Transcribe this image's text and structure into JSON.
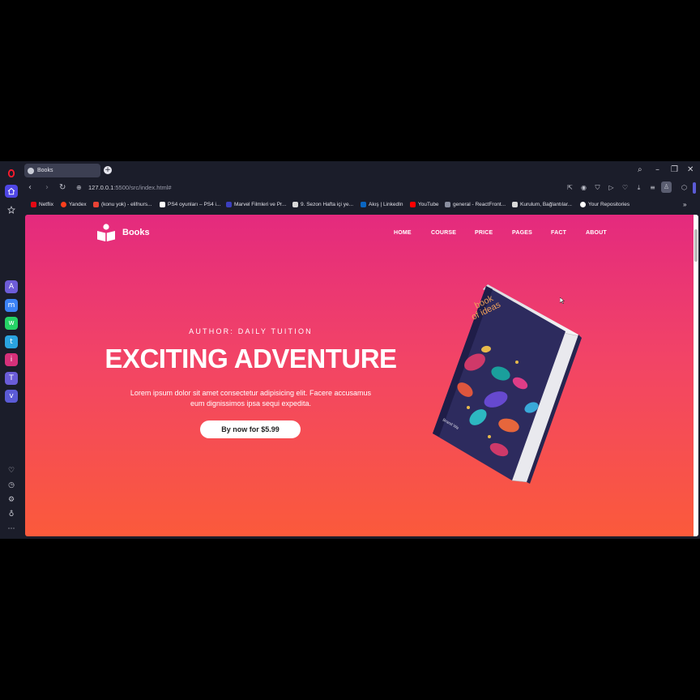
{
  "browser": {
    "tab": {
      "title": "Books"
    },
    "address": {
      "host": "127.0.0.1",
      "path": ":5500/src/index.html#"
    },
    "bookmarks": [
      {
        "label": "Netflix",
        "color": "#e50914"
      },
      {
        "label": "Yandex",
        "color": "#fc3f1d"
      },
      {
        "label": "(konu yok) - elifnurs...",
        "color": "#ea4335"
      },
      {
        "label": "PS4 oyunları – PS4 i...",
        "color": "#ffffff"
      },
      {
        "label": "Marvel Filmleri ve Pr...",
        "color": "#3b3fbf"
      },
      {
        "label": "9. Sezon Hafta içi ye...",
        "color": "#d9d9d9"
      },
      {
        "label": "Akış | LinkedIn",
        "color": "#0a66c2"
      },
      {
        "label": "YouTube",
        "color": "#ff0000"
      },
      {
        "label": "general - ReactFront...",
        "color": "#8a8fa0"
      },
      {
        "label": "Kurulum, Bağlantılar...",
        "color": "#d9d9d9"
      },
      {
        "label": "Your Repositories",
        "color": "#ffffff"
      }
    ]
  },
  "site": {
    "brand": "Books",
    "nav": [
      "HOME",
      "COURSE",
      "PRICE",
      "PAGES",
      "FACT",
      "ABOUT"
    ],
    "hero": {
      "author": "AUTHOR: DAILY TUITION",
      "title": "EXCITING ADVENTURE",
      "text_line1": "Lorem ipsum dolor sit amet consectetur adipisicing elit. Facere accusamus",
      "text_line2": "eum dignissimos ipsa sequi expedita.",
      "cta": "By now for $5.99"
    },
    "book": {
      "title_line1": "book",
      "title_line2": "of ideas",
      "author": "Brand Wa"
    }
  }
}
